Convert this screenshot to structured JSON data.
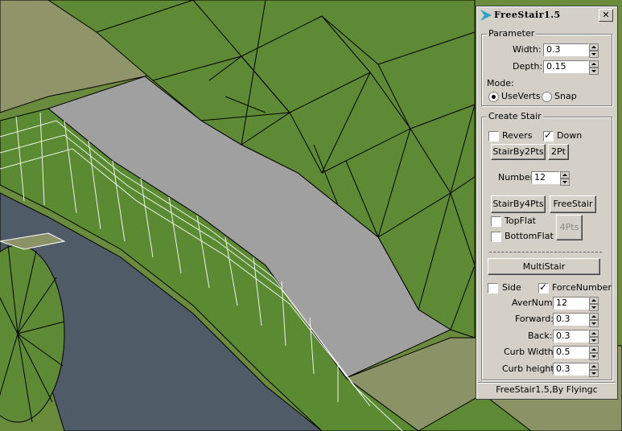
{
  "viewport": {
    "name": "3D terrain mesh viewport"
  },
  "window": {
    "title": "FreeStair1.5",
    "close_label": "✕"
  },
  "parameter": {
    "group_label": "Parameter",
    "width_label": "Width:",
    "width_value": "0.3",
    "depth_label": "Depth:",
    "depth_value": "0.15",
    "mode_label": "Mode:",
    "mode_options": [
      "UseVerts",
      "Snap"
    ],
    "mode_selected": "UseVerts"
  },
  "create_stair": {
    "group_label": "Create Stair",
    "revers_label": "Revers",
    "revers_checked": false,
    "down_label": "Down",
    "down_checked": true,
    "stair_by_2pts_label": "StairBy2Pts",
    "two_pt_label": "2Pt",
    "number_label": "Number",
    "number_value": "12",
    "stair_by_4pts_label": "StairBy4Pts",
    "free_stair_label": "FreeStair",
    "top_flat_label": "TopFlat",
    "top_flat_checked": false,
    "bottom_flat_label": "BottomFlat",
    "bottom_flat_checked": false,
    "four_pts_label": "4Pts",
    "multi_stair_label": "MultiStair",
    "side_label": "Side",
    "side_checked": false,
    "force_number_label": "ForceNumber",
    "force_number_checked": true,
    "aver_num_label": "AverNum:",
    "aver_num_value": "12",
    "forward_label": "Forward:",
    "forward_value": "0.3",
    "back_label": "Back:",
    "back_value": "0.3",
    "curb_width_label": "Curb Width:",
    "curb_width_value": "0.5",
    "curb_height_label": "Curb height:",
    "curb_height_value": "0.3"
  },
  "footer": {
    "text": "FreeStair1.5,By Flyingc"
  },
  "colors": {
    "grass": "#5e8a35",
    "grass_dark": "#3f6b22",
    "slab": "#a0a0a0",
    "road": "#4f5b67",
    "sand": "#8f9569",
    "panel_bg": "#d4d0c8"
  }
}
